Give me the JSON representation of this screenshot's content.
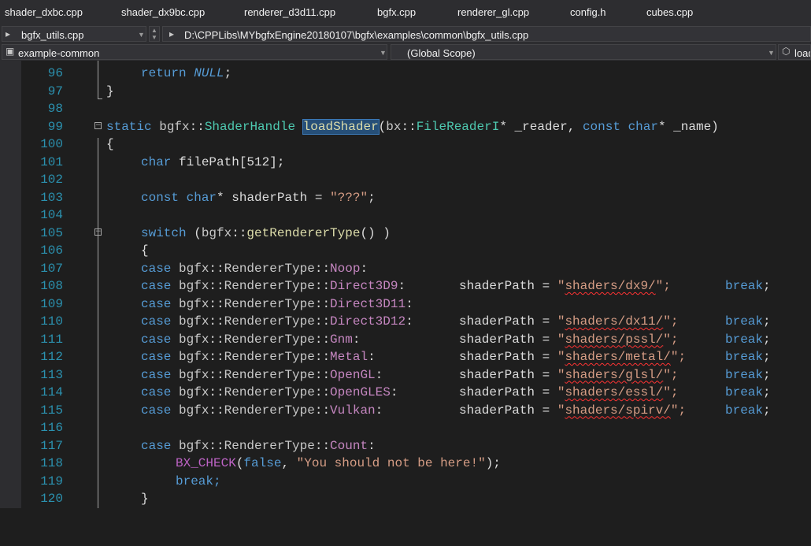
{
  "tabs": [
    {
      "label": "shader_dxbc.cpp"
    },
    {
      "label": "shader_dx9bc.cpp"
    },
    {
      "label": "renderer_d3d11.cpp"
    },
    {
      "label": "bgfx.cpp"
    },
    {
      "label": "renderer_gl.cpp"
    },
    {
      "label": "config.h"
    },
    {
      "label": "cubes.cpp"
    }
  ],
  "nav": {
    "file_combo": "bgfx_utils.cpp",
    "file_path": "D:\\CPPLibs\\MYbgfxEngine20180107\\bgfx\\examples\\common\\bgfx_utils.cpp",
    "project_combo": "example-common",
    "scope_combo": "(Global Scope)",
    "member_combo": "loadS"
  },
  "code": {
    "line_numbers": [
      "96",
      "97",
      "98",
      "99",
      "100",
      "101",
      "102",
      "103",
      "104",
      "105",
      "106",
      "107",
      "108",
      "109",
      "110",
      "111",
      "112",
      "113",
      "114",
      "115",
      "116",
      "117",
      "118",
      "119",
      "120"
    ],
    "l96_kw": "return",
    "l96_null": "NULL",
    "l96_end": ";",
    "l97": "}",
    "l99_static": "static",
    "l99_ns": "bgfx",
    "l99_sep": "::",
    "l99_type": "ShaderHandle",
    "l99_fn": "loadShader",
    "l99_open": "(",
    "l99_ns2": "bx",
    "l99_type2": "FileReaderI",
    "l99_p1": "* _reader, ",
    "l99_const": "const",
    "l99_char": "char",
    "l99_p2": "* _name)",
    "l100": "{",
    "l101_char": "char",
    "l101_rest": " filePath[512];",
    "l103_const": "const",
    "l103_char": "char",
    "l103_rest": "* shaderPath = ",
    "l103_str": "\"???\"",
    "l103_end": ";",
    "l105_switch": "switch",
    "l105_a": " (",
    "l105_ns": "bgfx",
    "l105_sep": "::",
    "l105_fn": "getRendererType",
    "l105_b": "() )",
    "l106": "{",
    "case_kw": "case",
    "ns_bgfx": "bgfx",
    "sep": "::",
    "renderer_type": "RendererType",
    "shader_path_assign": "shaderPath = ",
    "break_kw": "break",
    "cases": [
      {
        "enum": "Noop",
        "colon": ":"
      },
      {
        "enum": "Direct3D9",
        "colon": ":",
        "str_open": "\"",
        "str_path": "shaders/dx9/",
        "str_close": "\";"
      },
      {
        "enum": "Direct3D11",
        "colon": ":"
      },
      {
        "enum": "Direct3D12",
        "colon": ":",
        "str_open": "\"",
        "str_path": "shaders/dx11/",
        "str_close": "\";"
      },
      {
        "enum": "Gnm",
        "colon": ":",
        "str_open": "\"",
        "str_path": "shaders/pssl/",
        "str_close": "\";"
      },
      {
        "enum": "Metal",
        "colon": ":",
        "str_open": "\"",
        "str_path": "shaders/metal/",
        "str_close": "\";"
      },
      {
        "enum": "OpenGL",
        "colon": ":",
        "str_open": "\"",
        "str_path": "shaders/glsl/",
        "str_close": "\";"
      },
      {
        "enum": "OpenGLES",
        "colon": ":",
        "str_open": "\"",
        "str_path": "shaders/essl/",
        "str_close": "\";"
      },
      {
        "enum": "Vulkan",
        "colon": ":",
        "str_open": "\"",
        "str_path": "shaders/spirv/",
        "str_close": "\";"
      }
    ],
    "break_end": ";",
    "l117_enum": "Count",
    "l117_colon": ":",
    "l118_macro": "BX_CHECK",
    "l118_open": "(",
    "l118_false": "false",
    "l118_comma": ", ",
    "l118_str": "\"You should not be here!\"",
    "l118_end": ");",
    "l119": "break;",
    "l120": "}"
  }
}
